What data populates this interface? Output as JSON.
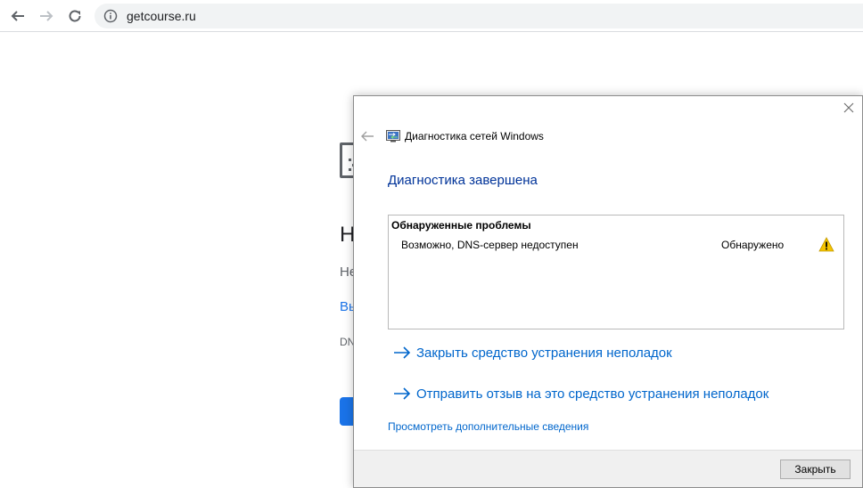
{
  "browser": {
    "url": "getcourse.ru"
  },
  "error_page": {
    "title": "Н",
    "description": "Не",
    "link": "Вы",
    "code": "DN"
  },
  "dialog": {
    "app_title": "Диагностика сетей Windows",
    "heading": "Диагностика завершена",
    "problems": {
      "title": "Обнаруженные проблемы",
      "items": [
        {
          "text": "Возможно, DNS-сервер недоступен",
          "status": "Обнаружено"
        }
      ]
    },
    "actions": [
      {
        "label": "Закрыть средство устранения неполадок"
      },
      {
        "label": "Отправить отзыв на это средство устранения неполадок"
      }
    ],
    "details_link": "Просмотреть дополнительные сведения",
    "close_button": "Закрыть"
  },
  "colors": {
    "link_blue": "#0066cc",
    "heading_blue": "#003399",
    "chrome_blue": "#1a73e8",
    "warning_yellow": "#f5c400"
  }
}
